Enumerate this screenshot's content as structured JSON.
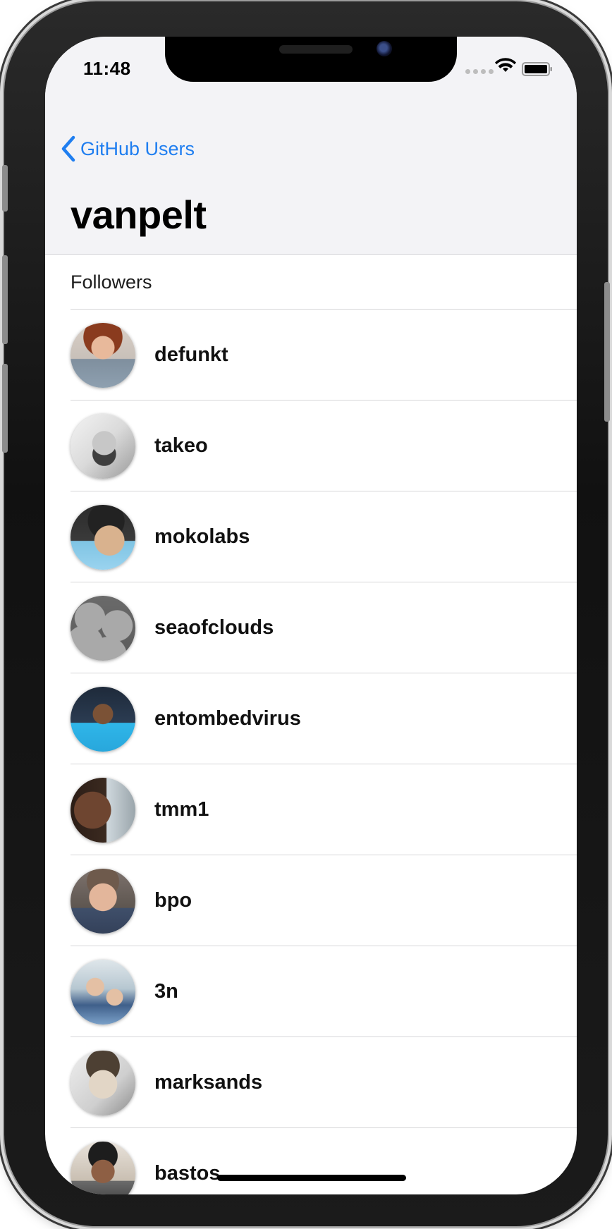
{
  "status_bar": {
    "time": "11:48",
    "icons": [
      "signal-dots-icon",
      "wifi-icon",
      "battery-icon"
    ]
  },
  "nav": {
    "back_label": "GitHub Users",
    "title": "vanpelt",
    "accent_color": "#1f7ef0"
  },
  "list": {
    "section_header": "Followers",
    "items": [
      {
        "username": "defunkt"
      },
      {
        "username": "takeo"
      },
      {
        "username": "mokolabs"
      },
      {
        "username": "seaofclouds"
      },
      {
        "username": "entombedvirus"
      },
      {
        "username": "tmm1"
      },
      {
        "username": "bpo"
      },
      {
        "username": "3n"
      },
      {
        "username": "marksands"
      },
      {
        "username": "bastos"
      }
    ]
  }
}
